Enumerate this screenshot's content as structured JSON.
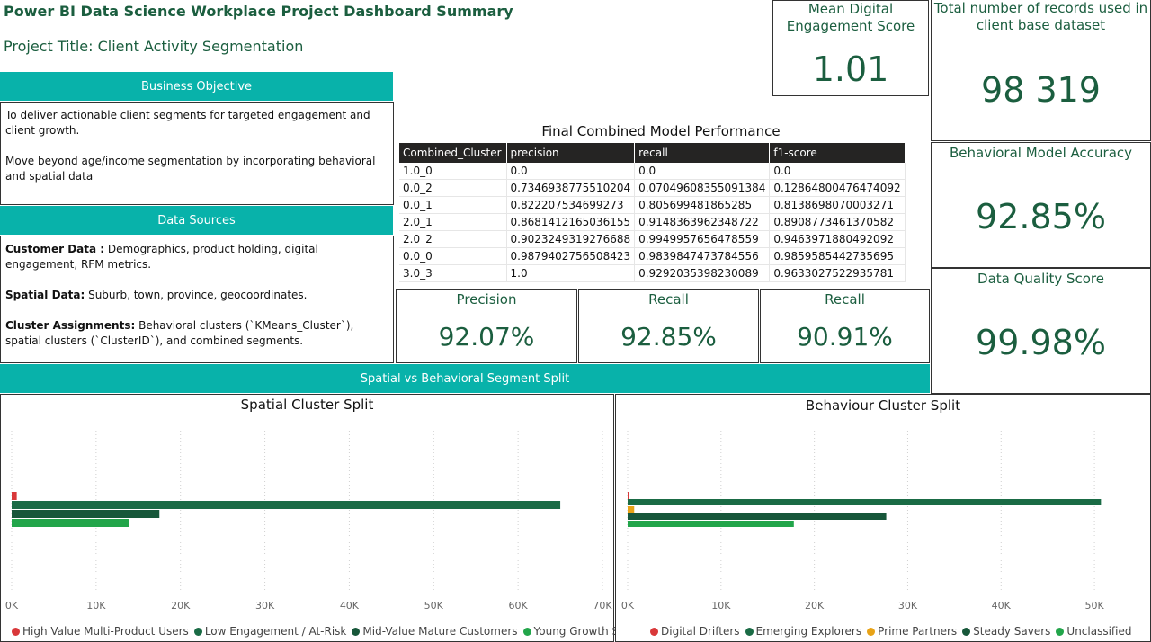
{
  "header": {
    "title": "Power BI Data Science Workplace Project Dashboard Summary",
    "subtitle": "Project Title: Client Activity Segmentation"
  },
  "business_objective": {
    "heading": "Business Objective",
    "paragraphs": [
      "To deliver actionable client segments for targeted engagement and client growth.",
      "Move beyond age/income segmentation by incorporating behavioral and spatial data"
    ]
  },
  "data_sources": {
    "heading": "Data Sources",
    "items": [
      {
        "label": "Customer Data :",
        "text": " Demographics, product holding, digital engagement, RFM metrics."
      },
      {
        "label": "Spatial Data:",
        "text": " Suburb, town, province, geocoordinates."
      },
      {
        "label": "Cluster Assignments:",
        "text": " Behavioral clusters (`KMeans_Cluster`), spatial clusters (`ClusterID`), and combined segments."
      }
    ]
  },
  "kpis": {
    "engagement": {
      "label": "Mean Digital Engagement Score",
      "value": "1.01"
    },
    "records": {
      "label": "Total number of records used in client base dataset",
      "value": "98 319"
    },
    "behavioral_accuracy": {
      "label": "Behavioral Model Accuracy",
      "value": "92.85%"
    },
    "data_quality": {
      "label": "Data Quality Score",
      "value": "99.98%"
    },
    "precision": {
      "label": "Precision",
      "value": "92.07%"
    },
    "recall": {
      "label": "Recall",
      "value": "92.85%"
    },
    "recall2": {
      "label": "Recall",
      "value": "90.91%"
    }
  },
  "performance_table": {
    "title": "Final Combined Model Performance",
    "columns": [
      "Combined_Cluster",
      "precision",
      "recall",
      "f1-score"
    ],
    "rows": [
      [
        "1.0_0",
        "0.0",
        "0.0",
        "0.0"
      ],
      [
        "0.0_2",
        "0.7346938775510204",
        "0.07049608355091384",
        "0.12864800476474092"
      ],
      [
        "0.0_1",
        "0.822207534699273",
        "0.805699481865285",
        "0.8138698070003271"
      ],
      [
        "2.0_1",
        "0.8681412165036155",
        "0.9148363962348722",
        "0.8908773461370582"
      ],
      [
        "2.0_2",
        "0.9023249319276688",
        "0.9949957656478559",
        "0.9463971880492092"
      ],
      [
        "0.0_0",
        "0.9879402756508423",
        "0.9839847473784556",
        "0.9859585442735695"
      ],
      [
        "3.0_3",
        "1.0",
        "0.9292035398230089",
        "0.9633027522935781"
      ]
    ]
  },
  "split_banner": {
    "label": "Spatial vs Behavioral Segment Split"
  },
  "chart_data": [
    {
      "type": "bar",
      "orientation": "horizontal",
      "title": "Spatial Cluster Split",
      "xlim": [
        0,
        70000
      ],
      "ticks": [
        "0K",
        "10K",
        "20K",
        "30K",
        "40K",
        "50K",
        "60K",
        "70K"
      ],
      "tick_values": [
        0,
        10000,
        20000,
        30000,
        40000,
        50000,
        60000,
        70000
      ],
      "grid": true,
      "legend_position": "bottom",
      "series": [
        {
          "name": "High Value Multi-Product Users",
          "color": "#d9383a",
          "value": 600
        },
        {
          "name": "Low Engagement / At-Risk",
          "color": "#1a6b45",
          "value": 65000
        },
        {
          "name": "Mid-Value Mature Customers",
          "color": "#17573a",
          "value": 17500
        },
        {
          "name": "Young Growth Segment",
          "color": "#22a54a",
          "value": 13900
        }
      ]
    },
    {
      "type": "bar",
      "orientation": "horizontal",
      "title": "Behaviour Cluster Split",
      "xlim": [
        0,
        55000
      ],
      "ticks": [
        "0K",
        "10K",
        "20K",
        "30K",
        "40K",
        "50K"
      ],
      "tick_values": [
        0,
        10000,
        20000,
        30000,
        40000,
        50000
      ],
      "grid": true,
      "legend_position": "bottom",
      "series": [
        {
          "name": "Digital Drifters",
          "color": "#d9383a",
          "value": 100
        },
        {
          "name": "Emerging Explorers",
          "color": "#1a6b45",
          "value": 50700
        },
        {
          "name": "Prime Partners",
          "color": "#e8a317",
          "value": 700
        },
        {
          "name": "Steady Savers",
          "color": "#17573a",
          "value": 27700
        },
        {
          "name": "Unclassified",
          "color": "#22a54a",
          "value": 17800
        }
      ]
    }
  ]
}
